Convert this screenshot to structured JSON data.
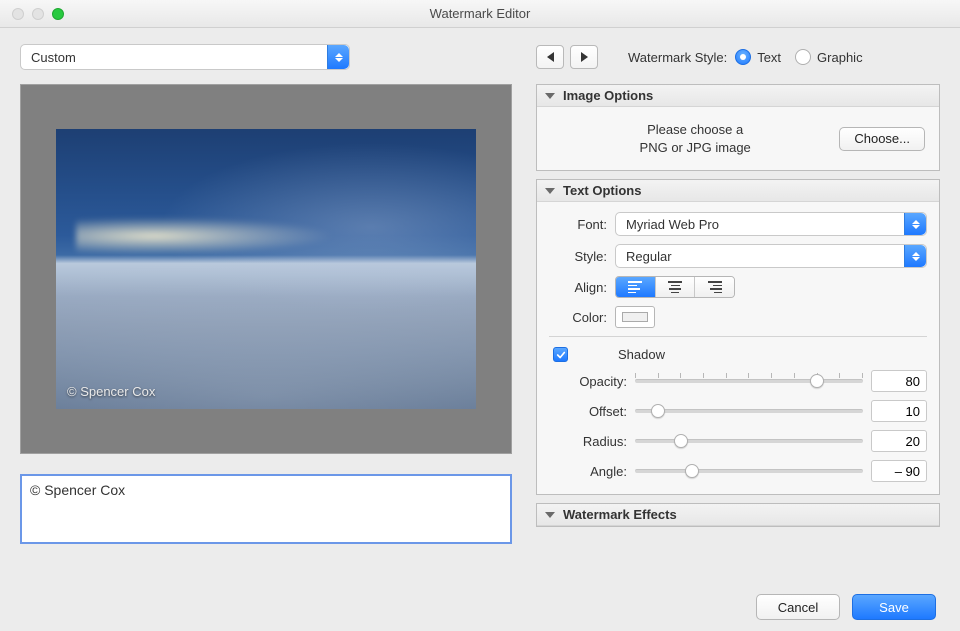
{
  "window": {
    "title": "Watermark Editor"
  },
  "preset": {
    "selected": "Custom"
  },
  "style": {
    "label": "Watermark Style:",
    "text": "Text",
    "graphic": "Graphic",
    "selected": "text"
  },
  "image_options": {
    "title": "Image Options",
    "hint_line1": "Please choose a",
    "hint_line2": "PNG or JPG image",
    "choose": "Choose..."
  },
  "text_options": {
    "title": "Text Options",
    "labels": {
      "font": "Font:",
      "style": "Style:",
      "align": "Align:",
      "color": "Color:"
    },
    "font": "Myriad Web Pro",
    "style": "Regular",
    "align": "left",
    "color": "#f0f0f0",
    "shadow": {
      "enabled": true,
      "label": "Shadow",
      "labels": {
        "opacity": "Opacity:",
        "offset": "Offset:",
        "radius": "Radius:",
        "angle": "Angle:"
      },
      "opacity": 80,
      "offset": 10,
      "radius": 20,
      "angle": "– 90"
    }
  },
  "effects": {
    "title": "Watermark Effects"
  },
  "watermark_text": "© Spencer Cox",
  "footer": {
    "cancel": "Cancel",
    "save": "Save"
  }
}
